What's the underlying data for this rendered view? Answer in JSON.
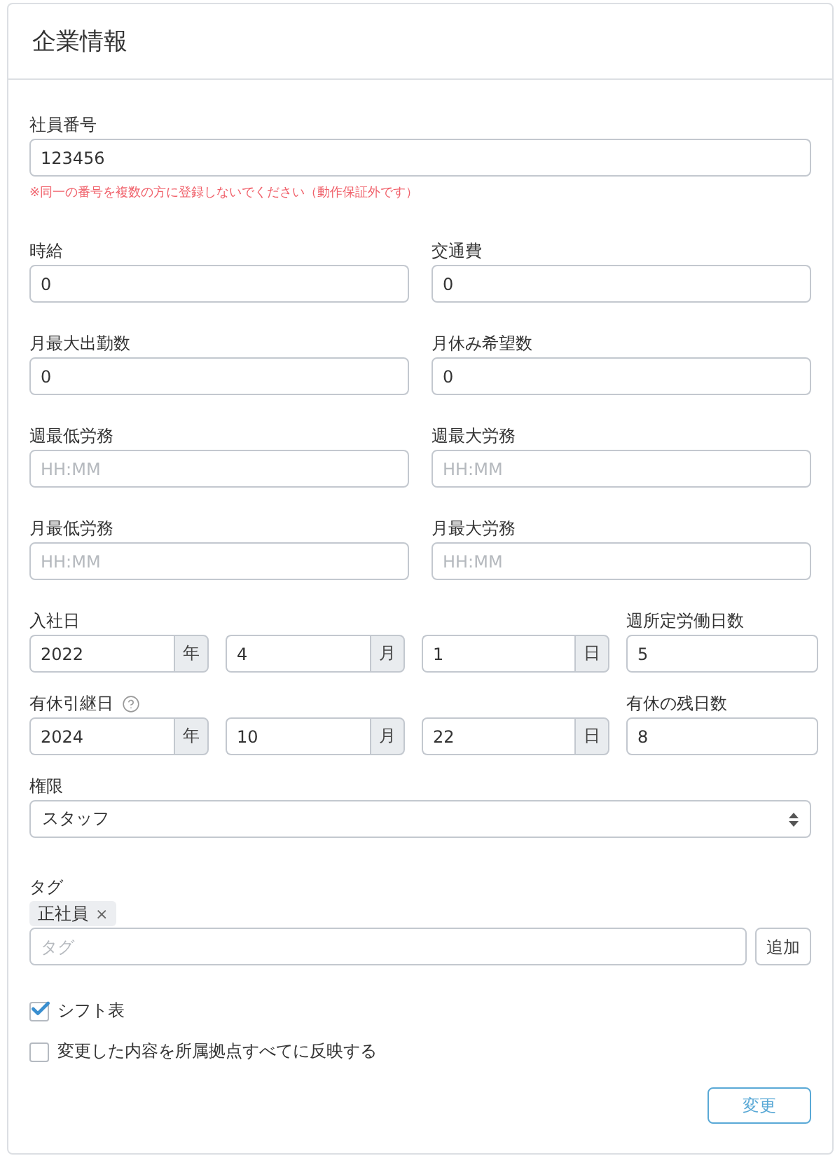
{
  "header": {
    "title": "企業情報"
  },
  "employee_number": {
    "label": "社員番号",
    "value": "123456",
    "note": "※同一の番号を複数の方に登録しないでください（動作保証外です）"
  },
  "field_pairs": [
    [
      {
        "label": "時給",
        "value": "0"
      },
      {
        "label": "交通費",
        "value": "0"
      }
    ],
    [
      {
        "label": "月最大出勤数",
        "value": "0"
      },
      {
        "label": "月休み希望数",
        "value": "0"
      }
    ],
    [
      {
        "label": "週最低労務",
        "placeholder": "HH:MM"
      },
      {
        "label": "週最大労務",
        "placeholder": "HH:MM"
      }
    ],
    [
      {
        "label": "月最低労務",
        "placeholder": "HH:MM"
      },
      {
        "label": "月最大労務",
        "placeholder": "HH:MM"
      }
    ]
  ],
  "date_rows": [
    {
      "label": "入社日",
      "help_icon": false,
      "parts": [
        {
          "value": "2022",
          "unit": "年"
        },
        {
          "value": "4",
          "unit": "月"
        },
        {
          "value": "1",
          "unit": "日"
        }
      ],
      "side": {
        "label": "週所定労働日数",
        "value": "5"
      }
    },
    {
      "label": "有休引継日",
      "help_icon": true,
      "parts": [
        {
          "value": "2024",
          "unit": "年"
        },
        {
          "value": "10",
          "unit": "月"
        },
        {
          "value": "22",
          "unit": "日"
        }
      ],
      "side": {
        "label": "有休の残日数",
        "value": "8"
      }
    }
  ],
  "permission": {
    "label": "権限",
    "value": "スタッフ"
  },
  "tags": {
    "label": "タグ",
    "items": [
      {
        "text": "正社員",
        "remove": "×"
      }
    ],
    "placeholder": "タグ",
    "add_button": "追加"
  },
  "checkboxes": [
    {
      "label": "シフト表",
      "checked": true
    },
    {
      "label": "変更した内容を所属拠点すべてに反映する",
      "checked": false
    }
  ],
  "submit_button": "変更"
}
